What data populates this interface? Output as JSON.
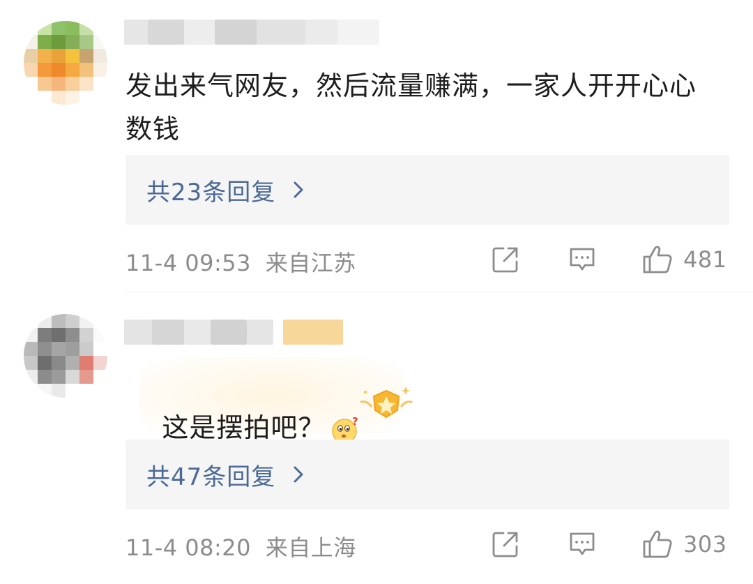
{
  "comments": [
    {
      "text": "发出来气网友，然后流量赚满，一家人开开心心数钱",
      "replies_label": "共23条回复",
      "timestamp": "11-4 09:53",
      "location": "来自江苏",
      "likes": "481",
      "avatar_colors": [
        "#ffffff",
        "#c9e3a7",
        "#8dc26a",
        "#8bbd5f",
        "#c6dfa8",
        "#ffffff",
        "#f4f1e9",
        "#7dae49",
        "#6e9c3c",
        "#84ae57",
        "#a7c887",
        "#f7f8f3",
        "#e9cfa5",
        "#f2b14a",
        "#e9a23a",
        "#f4c23c",
        "#c7a36f",
        "#efe9df",
        "#f7d6b0",
        "#f49a3a",
        "#ee8a2b",
        "#f6a843",
        "#f2c17c",
        "#faf1e6",
        "#ffffff",
        "#f7c891",
        "#f4b67c",
        "#f9cf9c",
        "#fbe3c7",
        "#ffffff",
        "#ffffff",
        "#ffffff",
        "#fbe9d3",
        "#fdf2e4",
        "#ffffff",
        "#ffffff"
      ]
    },
    {
      "text": "这是摆拍吧？",
      "replies_label": "共47条回复",
      "timestamp": "11-4 08:20",
      "location": "来自上海",
      "likes": "303",
      "avatar_colors": [
        "#ffffff",
        "#ececec",
        "#bdbdbd",
        "#cfcfcf",
        "#f2f2f2",
        "#ffffff",
        "#f2f2f2",
        "#7d7d7d",
        "#6f6f6f",
        "#8e8e8e",
        "#d2d2d2",
        "#fafafa",
        "#b9b9b9",
        "#8f8f8f",
        "#a5a5a5",
        "#9e9e9e",
        "#cbcbcb",
        "#ffffff",
        "#c8c8c8",
        "#6e6e6e",
        "#8a8a8a",
        "#b0b0b0",
        "#e07d73",
        "#f3d4cf",
        "#ededed",
        "#8c8c8c",
        "#9b9b9b",
        "#d9d9d9",
        "#e69a8e",
        "#ffffff",
        "#ffffff",
        "#f6f6f6",
        "#e9e9e9",
        "#ffffff",
        "#ffffff",
        "#ffffff"
      ]
    }
  ],
  "icons": {
    "share": "share-icon",
    "comment": "comment-icon",
    "like": "thumbs-up-icon",
    "chevron": "chevron-right-icon",
    "emoji": "wondering-face-emoji-icon",
    "badge": "star-badge-icon"
  },
  "colors": {
    "link": "#4b6996",
    "meta": "#8c8c8c",
    "reply_bg": "#f5f5f5"
  }
}
